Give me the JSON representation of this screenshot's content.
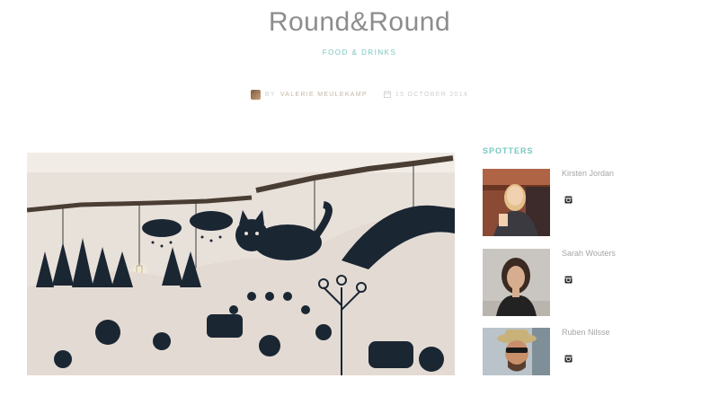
{
  "site": {
    "title": "Round&Round"
  },
  "post": {
    "category": "FOOD & DRINKS",
    "author_prefix": "BY",
    "author": "VALERIE MEULEKAMP",
    "date": "15 OCTOBER 2014"
  },
  "sidebar": {
    "title": "SPOTTERS",
    "spotters": [
      {
        "name": "Kirsten Jordan"
      },
      {
        "name": "Sarah Wouters"
      },
      {
        "name": "Ruben Nilsse"
      }
    ]
  },
  "icons": {
    "calendar": "calendar-icon",
    "instagram": "instagram-icon"
  },
  "colors": {
    "accent": "#79c7c0",
    "title": "#8d8d8d",
    "mural_ink": "#1b2633",
    "wall": "#e8e1da"
  }
}
